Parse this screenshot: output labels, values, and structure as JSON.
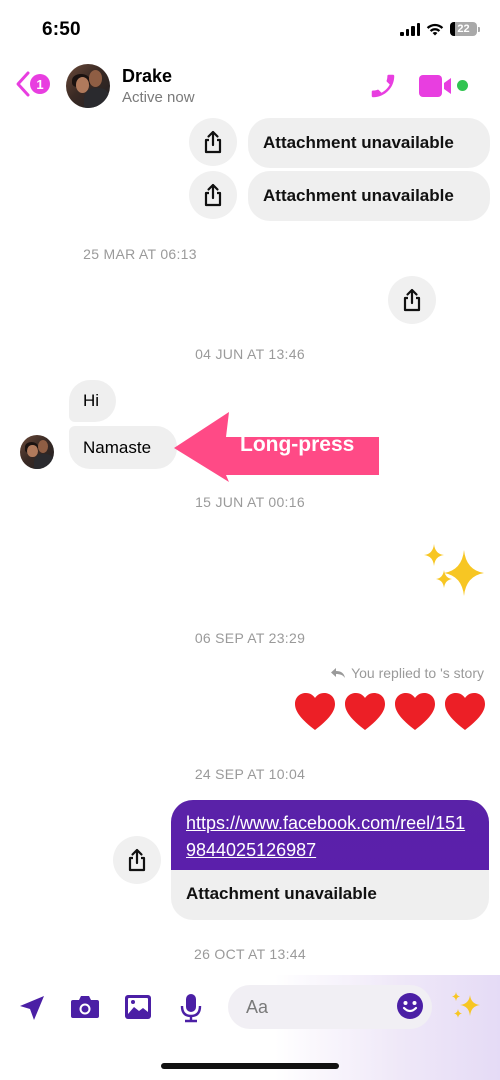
{
  "status_bar": {
    "time": "6:50",
    "battery_level": "22"
  },
  "header": {
    "back_badge_count": "1",
    "contact_name": "Drake",
    "contact_status": "Active now",
    "accent_color": "#e83ee0",
    "online_color": "#31c451",
    "icons": [
      "back-chevron-icon",
      "phone-icon",
      "video-camera-icon"
    ]
  },
  "messages": {
    "attachment_1": "Attachment unavailable",
    "attachment_2": "Attachment unavailable",
    "timestamp_1": "25 MAR AT 06:13",
    "timestamp_2": "04 JUN AT 13:46",
    "msg_hi": "Hi",
    "msg_namaste": "Namaste",
    "annotation_label": "Long-press",
    "annotation_color": "#ff4a86",
    "timestamp_3": "15 JUN AT 00:16",
    "sparkles_emoji": "✨",
    "timestamp_4": "06 SEP AT 23:29",
    "replied_story_text": "You replied to 's story",
    "hearts_emoji": [
      "❤️",
      "❤️",
      "❤️",
      "❤️"
    ],
    "timestamp_5": "24 SEP AT 10:04",
    "link_url": "https://www.facebook.com/reel/1519844025126987",
    "link_attachment": "Attachment unavailable",
    "timestamp_6": "26 OCT AT 13:44",
    "outgoing_color": "#5a22a8"
  },
  "composer": {
    "placeholder": "Aa",
    "icon_color": "#4b1fa5",
    "icons": [
      "location-arrow-icon",
      "camera-icon",
      "gallery-icon",
      "microphone-icon",
      "emoji-icon",
      "ai-sparkles-icon"
    ]
  }
}
